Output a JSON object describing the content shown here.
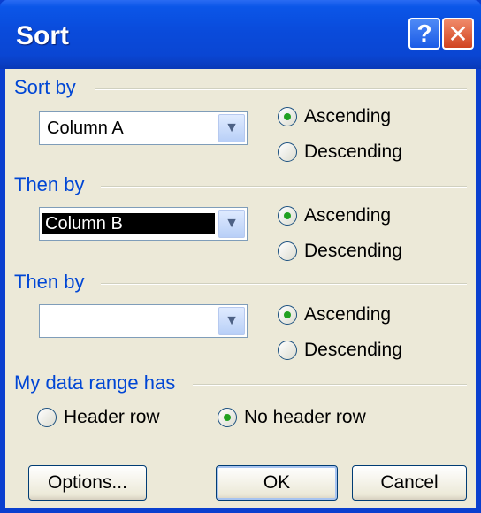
{
  "title": "Sort",
  "titlebar": {
    "help_glyph": "?",
    "close_glyph": "✕"
  },
  "groups": [
    {
      "label": "Sort by",
      "column": "Column A",
      "column_selected": false,
      "ascending": "Ascending",
      "descending": "Descending",
      "selected": "ascending"
    },
    {
      "label": "Then by",
      "column": "Column B",
      "column_selected": true,
      "ascending": "Ascending",
      "descending": "Descending",
      "selected": "ascending"
    },
    {
      "label": "Then by",
      "column": "",
      "column_selected": false,
      "ascending": "Ascending",
      "descending": "Descending",
      "selected": "ascending"
    }
  ],
  "data_range": {
    "label": "My data range has",
    "header_row": "Header row",
    "no_header_row": "No header row",
    "selected": "no_header_row"
  },
  "buttons": {
    "options": "Options...",
    "ok": "OK",
    "cancel": "Cancel"
  },
  "icons": {
    "dropdown_arrow": "chevron-down-icon"
  },
  "colors": {
    "accent": "#0046d5",
    "titlebar": "#0a4bdb",
    "radio_dot": "#21a121"
  }
}
